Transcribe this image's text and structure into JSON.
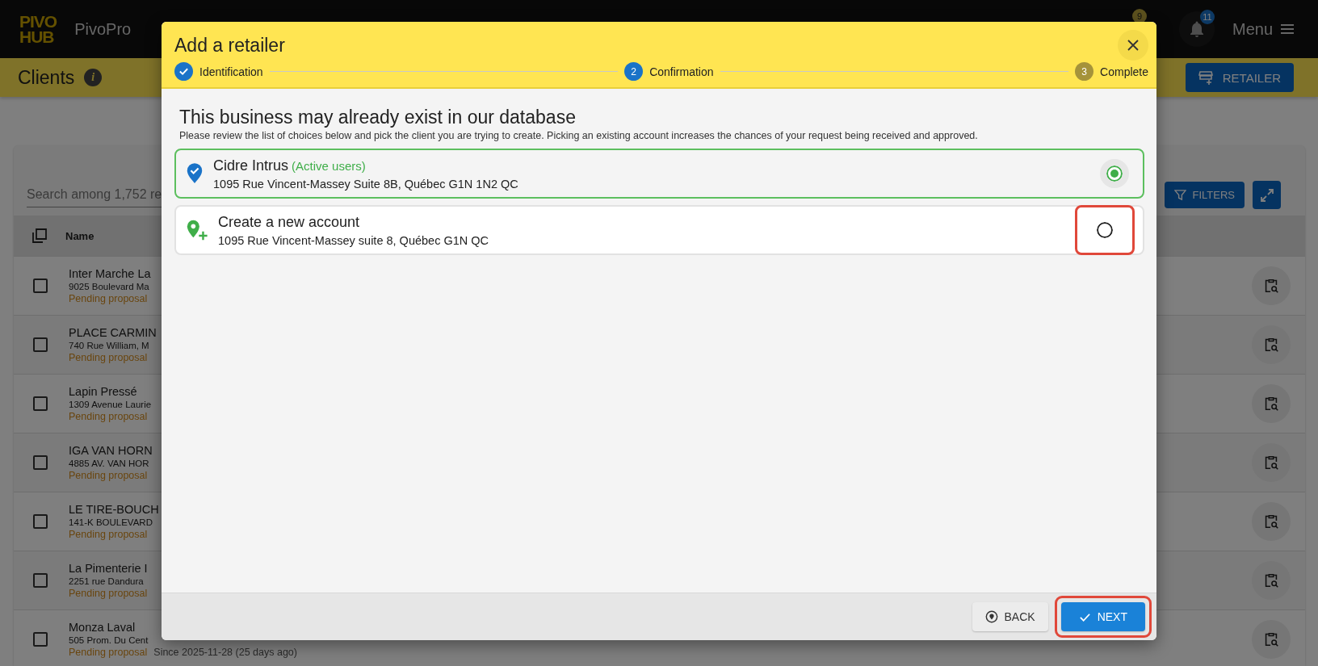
{
  "topbar": {
    "brand": "PivoPro",
    "logo_top": "PIVO",
    "logo_bottom": "HUB",
    "cart_badge": "9",
    "bell_badge": "11",
    "menu": "Menu"
  },
  "header": {
    "title": "Clients",
    "info": "i",
    "retailer_button": "RETAILER"
  },
  "table": {
    "search": {
      "placeholder": "Search among 1,752 re"
    },
    "filters_button": "FILTERS",
    "name_column": "Name",
    "rows": [
      {
        "name": "Inter Marche La",
        "address": "9025 Boulevard Ma",
        "status": "Pending proposal",
        "checked": false
      },
      {
        "name": "PLACE CARMIN",
        "address": "740 Rue William, M",
        "status": "Pending proposal",
        "checked": false
      },
      {
        "name": "Lapin Pressé",
        "address": "1309 Avenue Laurie",
        "status": "Pending proposal",
        "checked": false
      },
      {
        "name": "IGA VAN HORN",
        "address": "4885 AV. VAN HOR",
        "status": "Pending proposal",
        "checked": false
      },
      {
        "name": "LE TIRE-BOUCH",
        "address": "141-K BOULEVARD",
        "status": "Pending proposal",
        "checked": false
      },
      {
        "name": "La Pimenterie I",
        "address": "2251 rue Dandura",
        "status": "Pending proposal",
        "checked": false
      },
      {
        "name": "Monza Laval",
        "address": "505 Prom. Du Cent",
        "status": "Pending proposal",
        "since": "Since 2025-11-28 (25 days ago)",
        "checked": false
      }
    ]
  },
  "dialog": {
    "title": "Add a retailer",
    "steps": [
      {
        "label": "Identification",
        "kind": "done"
      },
      {
        "number": "2",
        "label": "Confirmation",
        "kind": "active"
      },
      {
        "number": "3",
        "label": "Complete",
        "kind": "todo"
      }
    ],
    "heading": "This business may already exist in our database",
    "intro": "Please review the list of choices below and pick the client you are trying to create. Picking an existing account increases the chances of your request being received and approved.",
    "options": [
      {
        "kind": "existing",
        "name": "Cidre Intrus",
        "tag": "(Active users)",
        "address": "1095 Rue Vincent-Massey Suite 8B, Québec G1N 1N2 QC",
        "selected": true,
        "highlighted": false
      },
      {
        "kind": "new",
        "name": "Create a new account",
        "address": "1095 Rue Vincent-Massey suite 8, Québec G1N QC",
        "selected": false,
        "highlighted": true
      }
    ],
    "back_button": {
      "label": "BACK"
    },
    "next_button": {
      "label": "NEXT",
      "highlighted": true
    }
  }
}
